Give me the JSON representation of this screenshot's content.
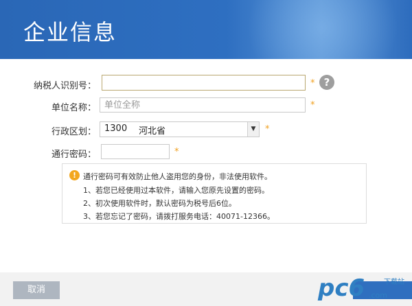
{
  "header": {
    "title": "企业信息"
  },
  "form": {
    "tax_id_label": "纳税人识别号：",
    "tax_id_value": "",
    "unit_name_label": "单位名称：",
    "unit_name_placeholder": "单位全称",
    "region_label": "行政区划：",
    "region_code": "1300",
    "region_name": "河北省",
    "password_label": "通行密码：",
    "password_value": "",
    "required_mark": "*",
    "help_symbol": "?"
  },
  "notice": {
    "icon": "!",
    "lines": [
      "通行密码可有效防止他人盗用您的身份，非法使用软件。",
      "1、若您已经使用过本软件，请输入您原先设置的密码。",
      "2、初次使用软件时，默认密码为税号后6位。",
      "3、若您忘记了密码，请拨打服务电话：40071-12366。"
    ]
  },
  "footer": {
    "cancel_label": "取消"
  },
  "watermark": {
    "logo_text": "pc6",
    "tag_top": "下载站",
    "tag_bottom": ".com"
  },
  "colors": {
    "header": "#2e6fc1",
    "required": "#f0a020",
    "warn": "#f3a71f",
    "cancel": "#aeb6c0"
  }
}
